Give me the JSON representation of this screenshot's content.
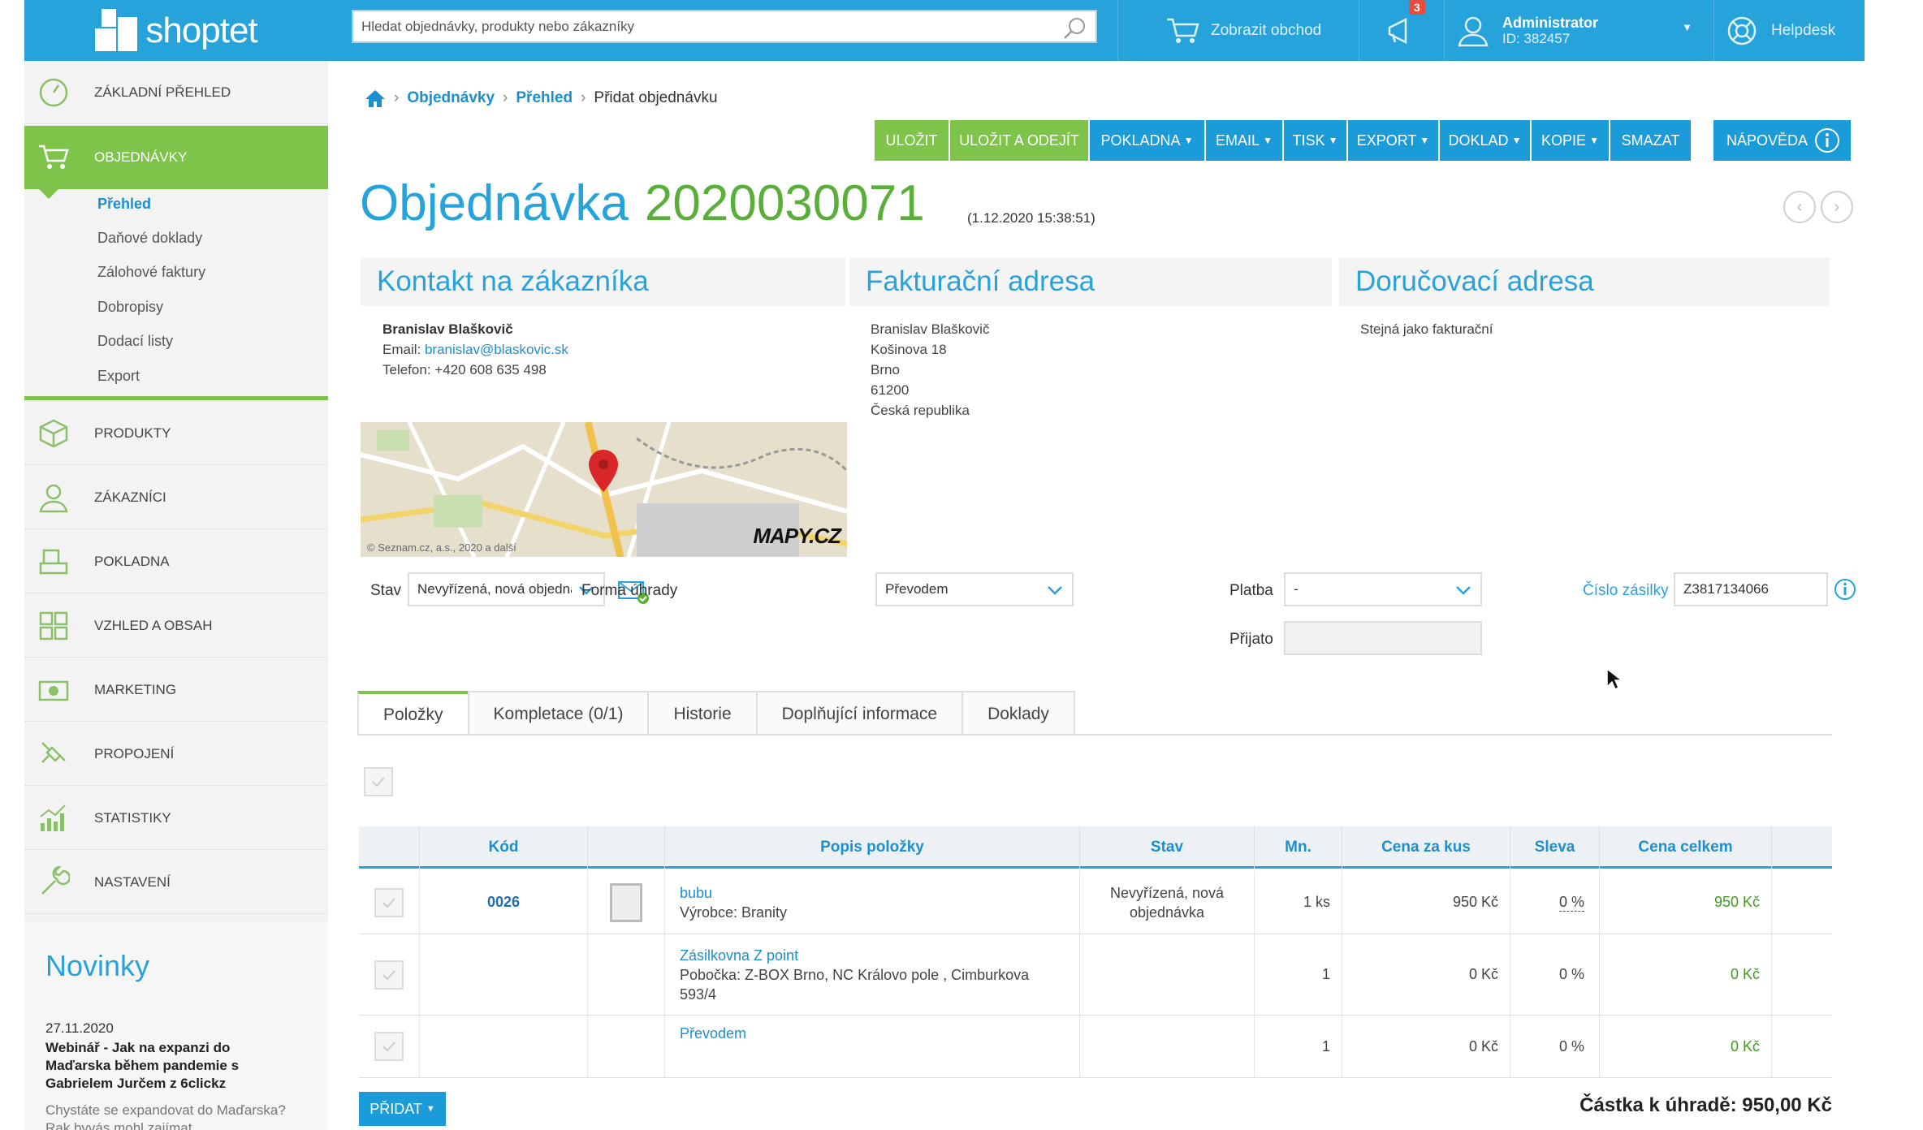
{
  "topbar": {
    "logo_text": "shoptet",
    "search_placeholder": "Hledat objednávky, produkty nebo zákazníky",
    "show_store": "Zobrazit obchod",
    "notifications_count": "3",
    "user_name": "Administrator",
    "user_id": "ID: 382457",
    "helpdesk": "Helpdesk"
  },
  "sidebar": {
    "items": [
      {
        "label": "Základní přehled",
        "icon": "dashboard-icon"
      },
      {
        "label": "Objednávky",
        "icon": "cart-icon"
      },
      {
        "label": "Produkty",
        "icon": "box-icon"
      },
      {
        "label": "Zákazníci",
        "icon": "user-icon"
      },
      {
        "label": "Pokladna",
        "icon": "register-icon"
      },
      {
        "label": "Vzhled a obsah",
        "icon": "layout-icon"
      },
      {
        "label": "Marketing",
        "icon": "marketing-icon"
      },
      {
        "label": "Propojení",
        "icon": "plug-icon"
      },
      {
        "label": "Statistiky",
        "icon": "chart-icon"
      },
      {
        "label": "Nastavení",
        "icon": "wrench-icon"
      }
    ],
    "subitems": [
      "Přehled",
      "Daňové doklady",
      "Zálohové faktury",
      "Dobropisy",
      "Dodací listy",
      "Export"
    ],
    "news": {
      "heading": "Novinky",
      "date": "27.11.2020",
      "title": "Webinář - Jak na expanzi do Maďarska během pandemie s Gabrielem Jurčem z 6clickz",
      "text": "Chystáte se expandovat do Maďarska? Rak byvás mohl zajímat"
    }
  },
  "breadcrumb": {
    "items": [
      "Objednávky",
      "Přehled"
    ],
    "current": "Přidat objednávku"
  },
  "toolbar": {
    "save": "Uložit",
    "save_exit": "Uložit a odejít",
    "pokladna": "Pokladna",
    "email": "Email",
    "tisk": "Tisk",
    "export": "Export",
    "doklad": "Doklad",
    "kopie": "Kopie",
    "smazat": "Smazat",
    "napoveda": "Nápověda"
  },
  "order": {
    "title": "Objednávka",
    "number": "2020030071",
    "date": "(1.12.2020 15:38:51)"
  },
  "contact": {
    "heading": "Kontakt na zákazníka",
    "name": "Branislav Blaškovič",
    "email_label": "Email:",
    "email": "branislav@blaskovic.sk",
    "phone": "Telefon: +420 608 635 498"
  },
  "billing": {
    "heading": "Fakturační adresa",
    "lines": [
      "Branislav Blaškovič",
      "Košinova 18",
      "Brno",
      "61200",
      "Česká republika"
    ]
  },
  "delivery": {
    "heading": "Doručovací adresa",
    "text": "Stejná jako fakturační"
  },
  "map": {
    "copyright": "© Seznam.cz, a.s., 2020 a další",
    "brand": "MAPY.CZ"
  },
  "form": {
    "stav_label": "Stav",
    "stav_value": "Nevyřízená, nová objednávka",
    "forma_label": "Forma úhrady",
    "forma_value": "Převodem",
    "platba_label": "Platba",
    "platba_value": "-",
    "prijato_label": "Přijato",
    "zasilka_label": "Číslo zásilky",
    "zasilka_value": "Z3817134066"
  },
  "tabs": [
    "Položky",
    "Kompletace (0/1)",
    "Historie",
    "Doplňující informace",
    "Doklady"
  ],
  "table": {
    "headers": [
      "Kód",
      "Popis položky",
      "Stav",
      "Mn.",
      "Cena za kus",
      "Sleva",
      "Cena celkem"
    ],
    "rows": [
      {
        "code": "0026",
        "name": "bubu",
        "desc": "Výrobce: Branity",
        "status": "Nevyřízená, nová objednávka",
        "qty": "1 ks",
        "price": "950 Kč",
        "discount": "0 %",
        "total": "950 Kč"
      },
      {
        "code": "",
        "name": "Zásilkovna Z point",
        "desc": "Pobočka: Z-BOX Brno, NC Královo pole , Cimburkova 593/4",
        "status": "",
        "qty": "1",
        "price": "0 Kč",
        "discount": "0 %",
        "total": "0 Kč"
      },
      {
        "code": "",
        "name": "Převodem",
        "desc": "",
        "status": "",
        "qty": "1",
        "price": "0 Kč",
        "discount": "0 %",
        "total": "0 Kč"
      }
    ]
  },
  "footer": {
    "add_button": "Přidat",
    "total": "Částka k úhradě: 950,00 Kč"
  },
  "colors": {
    "brand_blue": "#27a3dc",
    "accent_green": "#7ec44a",
    "link": "#1c8fcf"
  }
}
